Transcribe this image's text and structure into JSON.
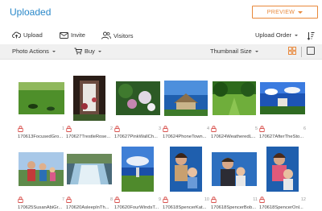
{
  "header": {
    "title": "Uploaded",
    "preview_label": "PREVIEW"
  },
  "toolbar": {
    "upload_label": "Upload",
    "invite_label": "Invite",
    "visitors_label": "Visitors",
    "upload_order_label": "Upload Order"
  },
  "subtoolbar": {
    "photo_actions_label": "Photo Actions",
    "buy_label": "Buy",
    "thumbnail_size_label": "Thumbnail Size"
  },
  "photos": [
    {
      "name": "170613FocusedGro...",
      "num": "1"
    },
    {
      "name": "170627TrestleRose...",
      "num": "2"
    },
    {
      "name": "170627PinkWallCh...",
      "num": "3"
    },
    {
      "name": "170624PhoneTown...",
      "num": "4"
    },
    {
      "name": "170624WeatheredL...",
      "num": "5"
    },
    {
      "name": "170627AfterTheSto...",
      "num": "6"
    },
    {
      "name": "170625SusanAbiGr...",
      "num": "7"
    },
    {
      "name": "170620AsleepInTh...",
      "num": "8"
    },
    {
      "name": "170620FourWindsT...",
      "num": "9"
    },
    {
      "name": "170618SpencerKat...",
      "num": "10"
    },
    {
      "name": "170618SpencerBob...",
      "num": "11"
    },
    {
      "name": "170618SpencerOnl...",
      "num": "12"
    }
  ]
}
